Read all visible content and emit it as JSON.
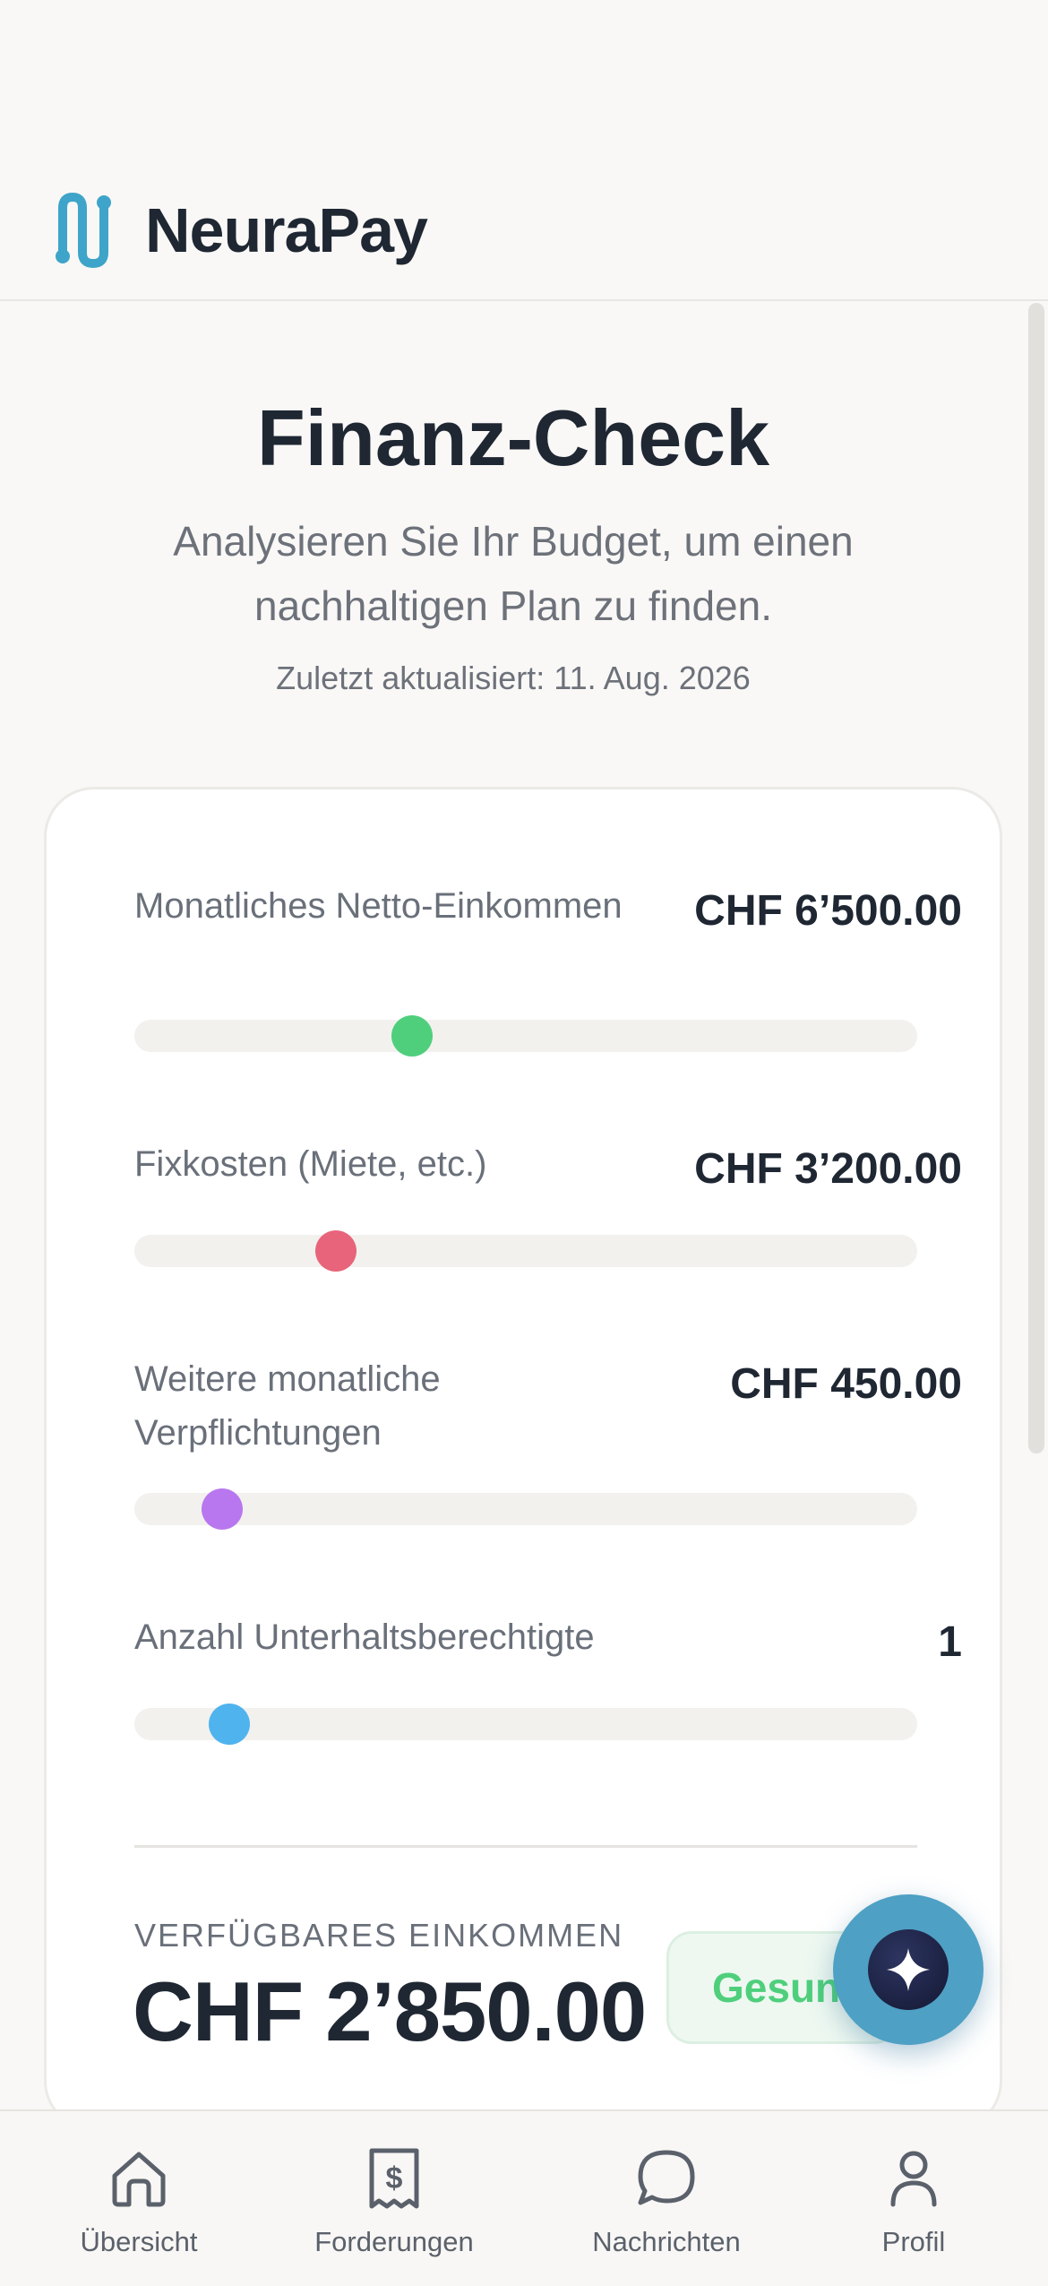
{
  "app": {
    "name": "NeuraPay"
  },
  "hero": {
    "title": "Finanz-Check",
    "subtitle": "Analysieren Sie Ihr Budget, um einen nachhaltigen Plan zu finden.",
    "updated": "Zuletzt aktualisiert: 11. Aug. 2026"
  },
  "sliders": [
    {
      "label": "Monatliches Netto-Einkommen",
      "value": "CHF 6’500.00",
      "fraction": 0.355,
      "color": "#4fcf7c"
    },
    {
      "label": "Fixkosten (Miete, etc.)",
      "value": "CHF 3’200.00",
      "fraction": 0.258,
      "color": "#e8647a"
    },
    {
      "label": "Weitere monatliche Verpflichtungen",
      "value": "CHF 450.00",
      "fraction": 0.112,
      "color": "#b877ee"
    },
    {
      "label": "Anzahl Unterhaltsberechtigte",
      "value": "1",
      "fraction": 0.121,
      "color": "#4fb3ee"
    }
  ],
  "summary": {
    "available_label": "VERFÜGBARES EINKOMMEN",
    "available_value": "CHF 2’850.00",
    "status": "Gesund"
  },
  "fab": {
    "icon": "sparkle-icon"
  },
  "nav": [
    {
      "label": "Übersicht",
      "icon": "home-icon"
    },
    {
      "label": "Forderungen",
      "icon": "receipt-icon"
    },
    {
      "label": "Nachrichten",
      "icon": "chat-icon"
    },
    {
      "label": "Profil",
      "icon": "person-icon"
    }
  ]
}
